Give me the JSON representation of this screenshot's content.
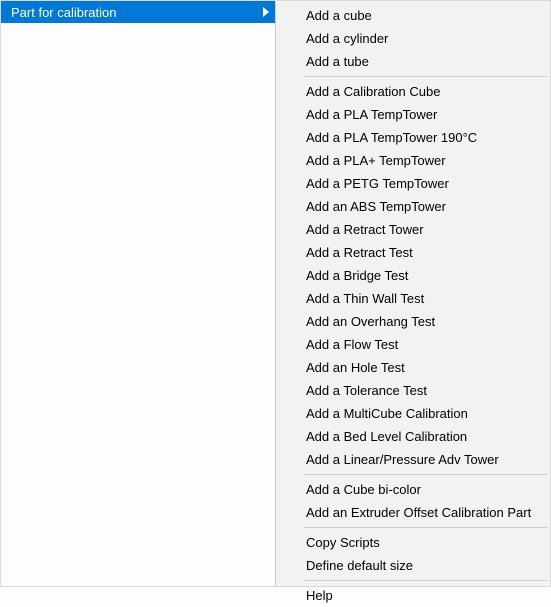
{
  "parent": {
    "label": "Part for calibration"
  },
  "submenu": {
    "groups": [
      [
        "Add a cube",
        "Add a cylinder",
        "Add a tube"
      ],
      [
        "Add a Calibration Cube",
        "Add a PLA TempTower",
        "Add a PLA TempTower 190°C",
        "Add a PLA+ TempTower",
        "Add a PETG TempTower",
        "Add an ABS TempTower",
        "Add a Retract Tower",
        "Add a Retract Test",
        "Add a Bridge Test",
        "Add a Thin Wall Test",
        "Add an Overhang Test",
        "Add a Flow Test",
        "Add an Hole Test",
        "Add a Tolerance Test",
        "Add a MultiCube Calibration",
        "Add a Bed Level Calibration",
        "Add a Linear/Pressure Adv Tower"
      ],
      [
        "Add a Cube bi-color",
        "Add an Extruder Offset Calibration Part"
      ],
      [
        "Copy Scripts",
        "Define default size"
      ],
      [
        "Help"
      ]
    ]
  }
}
